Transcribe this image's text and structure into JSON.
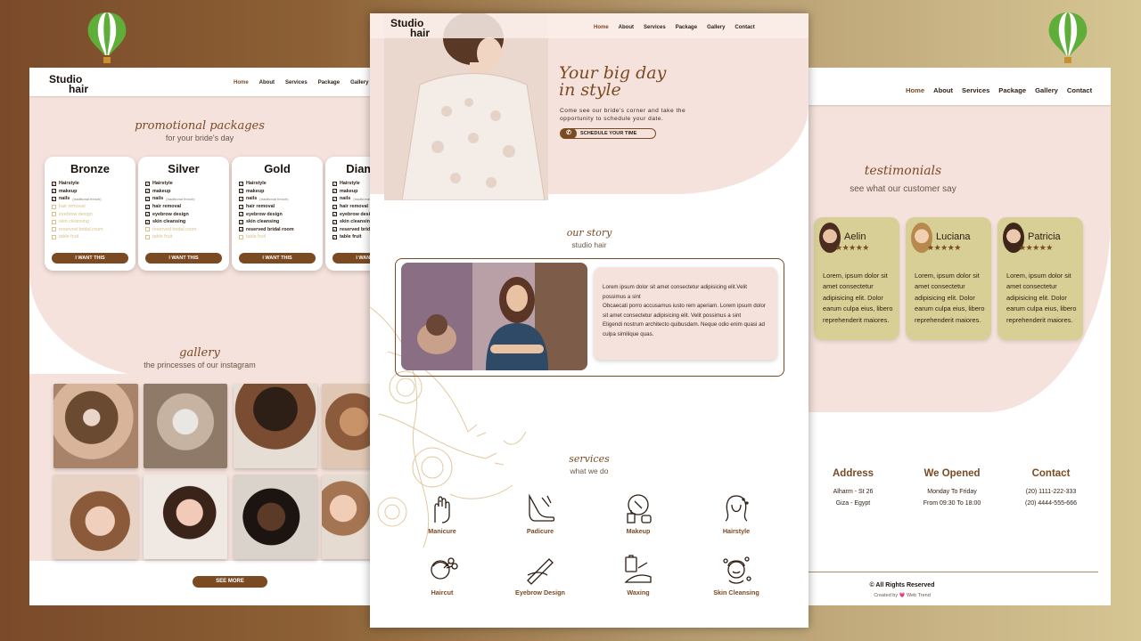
{
  "brand": {
    "line1": "Studio",
    "line2": "hair"
  },
  "nav": {
    "items": [
      "Home",
      "About",
      "Services",
      "Package",
      "Gallery",
      "Contact"
    ],
    "active": "Home"
  },
  "hero": {
    "title_line1": "Your big day",
    "title_line2": "in style",
    "text": "Come see our bride's corner and take the opportunity to schedule your date.",
    "button": "SCHEDULE YOUR TIME"
  },
  "story": {
    "title": "our story",
    "subtitle": "studio hair",
    "paragraphs": [
      "Lorem ipsum dolor sit amet consectetur adipisicing elit.Velit possimus a sint",
      "Obcaecati porro accusamus iusto rem aperiam. Lorem ipsum dolor sit amet consectetur adipisicing elit. Velit possimus a sint",
      "Eligendi nostrum architecto quibusdam. Neque odio enim quasi ad culpa similique quas."
    ]
  },
  "services": {
    "title": "services",
    "subtitle": "what we do",
    "items": [
      {
        "label": "Manicure",
        "icon": "manicure-icon"
      },
      {
        "label": "Padicure",
        "icon": "pedicure-icon"
      },
      {
        "label": "Makeup",
        "icon": "makeup-icon"
      },
      {
        "label": "Hairstyle",
        "icon": "hairstyle-icon"
      },
      {
        "label": "Haircut",
        "icon": "haircut-icon"
      },
      {
        "label": "Eyebrow Design",
        "icon": "eyebrow-icon"
      },
      {
        "label": "Waxing",
        "icon": "waxing-icon"
      },
      {
        "label": "Skin Cleansing",
        "icon": "skin-cleansing-icon"
      }
    ]
  },
  "packages": {
    "title": "promotional packages",
    "subtitle": "for your bride's day",
    "button": "I WANT THIS",
    "items": [
      {
        "name": "Bronze",
        "included": 3
      },
      {
        "name": "Silver",
        "included": 6
      },
      {
        "name": "Gold",
        "included": 7
      },
      {
        "name": "Diamond",
        "included": 8
      }
    ],
    "features": [
      "Hairstyle",
      "makeup",
      "nails",
      "hair removal",
      "eyebrow design",
      "skin cleansing",
      "reserved bridal room",
      "table fruit"
    ],
    "nails_note": "(traditional french)"
  },
  "gallery": {
    "title": "gallery",
    "subtitle": "the princesses of our instagram",
    "button": "SEE MORE"
  },
  "testimonials": {
    "title": "testimonials",
    "subtitle": "see what our customer say",
    "stars": "★★★★★",
    "items": [
      {
        "name": "Aelin",
        "text": "Lorem, ipsum dolor sit amet consectetur adipisicing elit. Dolor earum culpa eius, libero reprehenderit maiores."
      },
      {
        "name": "Luciana",
        "text": "Lorem, ipsum dolor sit amet consectetur adipisicing elit. Dolor earum culpa eius, libero reprehenderit maiores."
      },
      {
        "name": "Patricia",
        "text": "Lorem, ipsum dolor sit amet consectetur adipisicing elit. Dolor earum culpa eius, libero reprehenderit maiores."
      }
    ]
  },
  "footer": {
    "address": {
      "heading": "Address",
      "line1": "Alharm - St 26",
      "line2": "Giza - Egypt"
    },
    "opened": {
      "heading": "We Opened",
      "line1": "Monday To Friday",
      "line2": "From 09:30 To 18:00"
    },
    "contact": {
      "heading": "Contact",
      "line1": "(20) 1111-222-333",
      "line2": "(20) 4444-555-666"
    },
    "copyright": "© All Rights Reserved",
    "credit": "Created by 💗 Web Trend"
  },
  "colors": {
    "accent": "#7a4a23",
    "pink": "#f5e2dc",
    "olive": "#d8cf96"
  }
}
